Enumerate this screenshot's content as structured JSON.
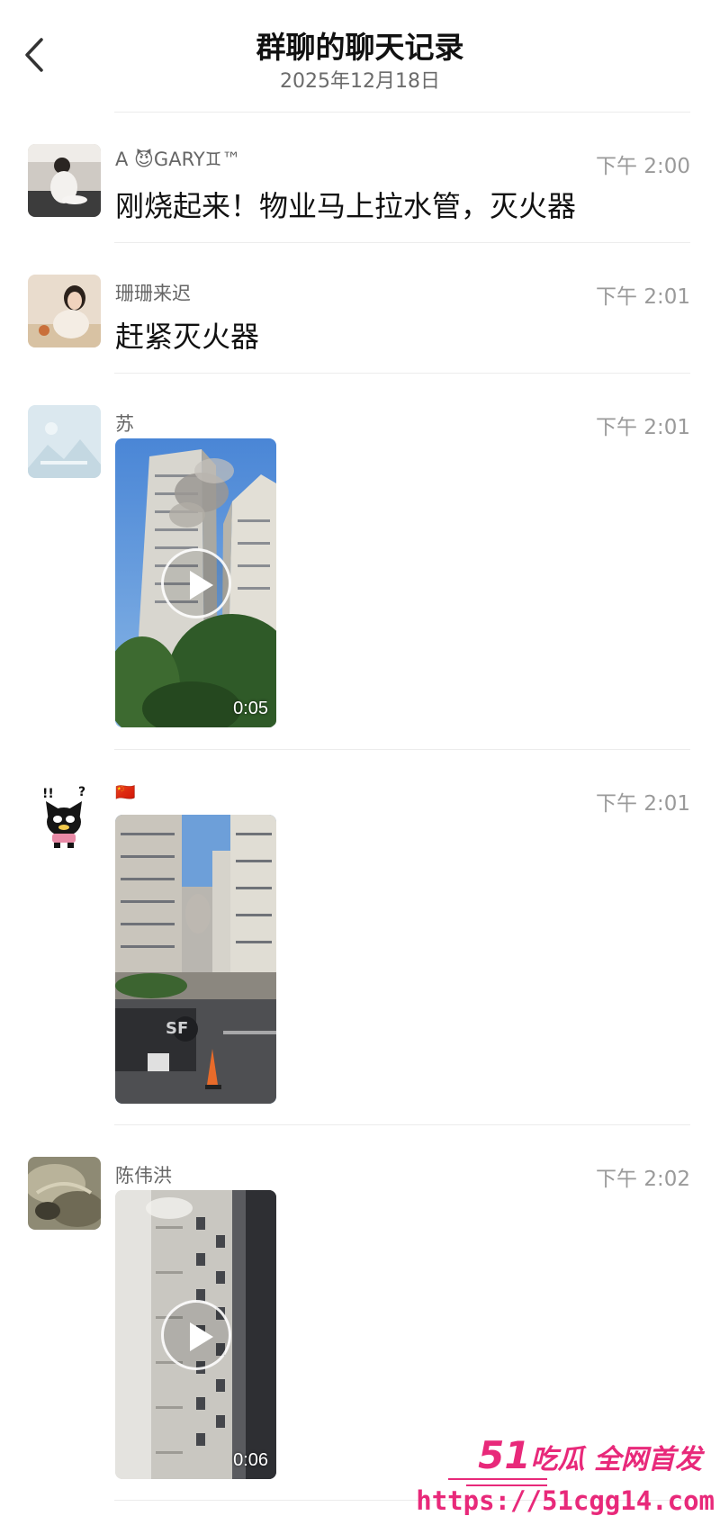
{
  "header": {
    "title": "群聊的聊天记录",
    "date": "2025年12月18日",
    "back_icon": "chevron-left-icon"
  },
  "messages": [
    {
      "sender": "A  😈GARY♊™",
      "time": "下午 2:00",
      "text": "刚烧起来！物业马上拉水管，灭火器"
    },
    {
      "sender": "珊珊来迟",
      "time": "下午 2:01",
      "text": "赶紧灭火器"
    },
    {
      "sender": "苏",
      "time": "下午 2:01",
      "video_duration": "0:05"
    },
    {
      "sender": "🇨🇳",
      "time": "下午 2:01"
    },
    {
      "sender": "陈伟洪",
      "time": "下午 2:02",
      "video_duration": "0:06"
    }
  ],
  "watermark": {
    "brand_number": "51",
    "brand_text": "吃瓜 全网首发",
    "url": "https://51cgg14.com"
  },
  "colors": {
    "accent_watermark": "#e8297a",
    "divider": "#ececec",
    "time_text": "#9a9a9a"
  }
}
